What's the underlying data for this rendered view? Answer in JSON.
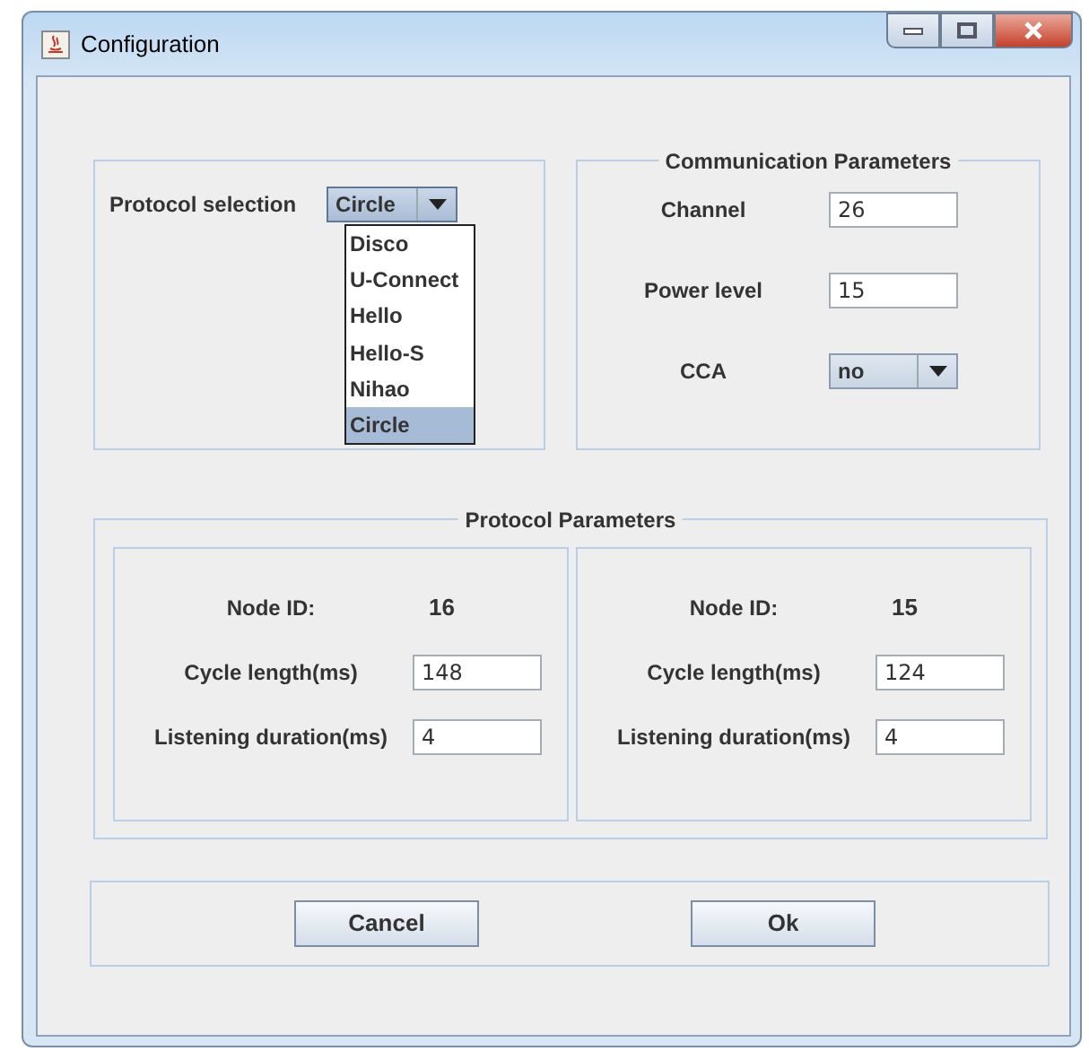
{
  "window": {
    "title": "Configuration"
  },
  "protocol_selection": {
    "label": "Protocol selection",
    "value": "Circle",
    "expanded": true,
    "options": [
      {
        "label": "Disco",
        "selected": false
      },
      {
        "label": "U-Connect",
        "selected": false
      },
      {
        "label": "Hello",
        "selected": false
      },
      {
        "label": "Hello-S",
        "selected": false
      },
      {
        "label": "Nihao",
        "selected": false
      },
      {
        "label": "Circle",
        "selected": true
      }
    ]
  },
  "communication_parameters": {
    "title": "Communication Parameters",
    "fields": [
      {
        "kind": "text",
        "label": "Channel",
        "value": "26"
      },
      {
        "kind": "text",
        "label": "Power level",
        "value": "15"
      },
      {
        "kind": "combo",
        "label": "CCA",
        "value": "no"
      }
    ]
  },
  "protocol_parameters": {
    "title": "Protocol Parameters",
    "nodes": [
      {
        "node_id_label": "Node ID:",
        "node_id": "16",
        "fields": [
          {
            "label": "Cycle length(ms)",
            "value": "148"
          },
          {
            "label": "Listening duration(ms)",
            "value": "4"
          }
        ]
      },
      {
        "node_id_label": "Node ID:",
        "node_id": "15",
        "fields": [
          {
            "label": "Cycle length(ms)",
            "value": "124"
          },
          {
            "label": "Listening duration(ms)",
            "value": "4"
          }
        ]
      }
    ]
  },
  "buttons": [
    "Cancel",
    "Ok"
  ]
}
